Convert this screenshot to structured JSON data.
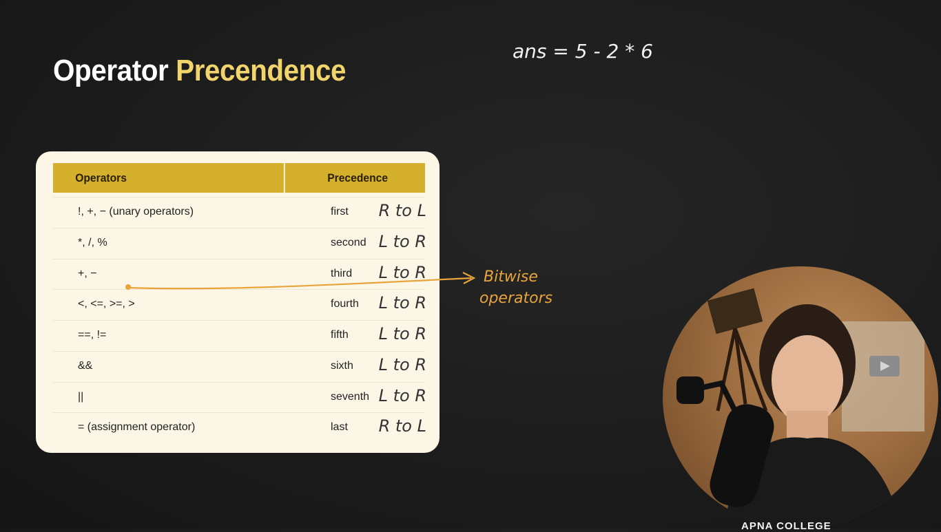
{
  "title": {
    "main": "Operator",
    "accent": "Precendence"
  },
  "table": {
    "headers": {
      "operators": "Operators",
      "precedence": "Precedence"
    },
    "rows": [
      {
        "op": "!, +, − (unary operators)",
        "rank": "first",
        "assoc": "R to L"
      },
      {
        "op": "*, /, %",
        "rank": "second",
        "assoc": "L to R"
      },
      {
        "op": "+, −",
        "rank": "third",
        "assoc": "L to R"
      },
      {
        "op": "<, <=, >=, >",
        "rank": "fourth",
        "assoc": "L to R"
      },
      {
        "op": "==, !=",
        "rank": "fifth",
        "assoc": "L to R"
      },
      {
        "op": "&&",
        "rank": "sixth",
        "assoc": "L to R"
      },
      {
        "op": "||",
        "rank": "seventh",
        "assoc": "L to R"
      },
      {
        "op": "=   (assignment operator)",
        "rank": "last",
        "assoc": "R to L"
      }
    ]
  },
  "annotations": {
    "equation": "ans = 5 - 2 * 6",
    "bitwise_note_line1": "Bitwise",
    "bitwise_note_line2": "operators",
    "ink_color": "#e8a43a",
    "chalk_color": "#f2f2f2"
  },
  "webcam": {
    "brand": "APNA COLLEGE"
  },
  "colors": {
    "background": "#1c1c1c",
    "card": "#fbf6e6",
    "header_fill": "#d4b02c",
    "title_accent": "#f1d46c"
  }
}
